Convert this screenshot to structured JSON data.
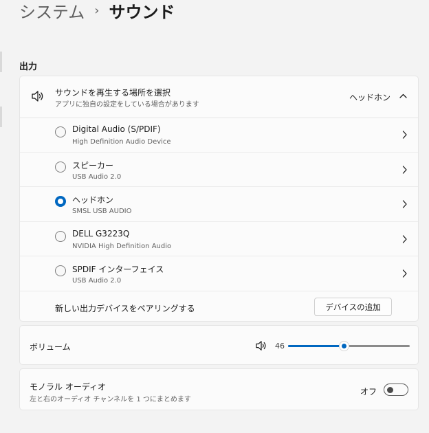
{
  "breadcrumb": {
    "parent": "システム",
    "separator": "›",
    "current": "サウンド"
  },
  "output": {
    "section_title": "出力",
    "header": {
      "title": "サウンドを再生する場所を選択",
      "subtitle": "アプリに独自の設定をしている場合があります",
      "selected": "ヘッドホン",
      "icon": "speaker-icon",
      "expanded": true
    },
    "devices": [
      {
        "name": "Digital Audio (S/PDIF)",
        "description": "High Definition Audio Device",
        "selected": false
      },
      {
        "name": "スピーカー",
        "description": "USB Audio 2.0",
        "selected": false
      },
      {
        "name": "ヘッドホン",
        "description": "SMSL USB AUDIO",
        "selected": true
      },
      {
        "name": "DELL G3223Q",
        "description": "NVIDIA High Definition Audio",
        "selected": false
      },
      {
        "name": "SPDIF インターフェイス",
        "description": "USB Audio 2.0",
        "selected": false
      }
    ],
    "pair": {
      "label": "新しい出力デバイスをペアリングする",
      "button": "デバイスの追加"
    }
  },
  "volume": {
    "label": "ボリューム",
    "value": "46",
    "level_percent": 46,
    "icon": "speaker-icon"
  },
  "mono": {
    "title": "モノラル オーディオ",
    "subtitle": "左と右のオーディオ チャンネルを 1 つにまとめます",
    "state_label": "オフ",
    "on": false
  },
  "colors": {
    "accent": "#0067c0",
    "background": "#f3f3f3",
    "card": "#fbfbfb"
  }
}
